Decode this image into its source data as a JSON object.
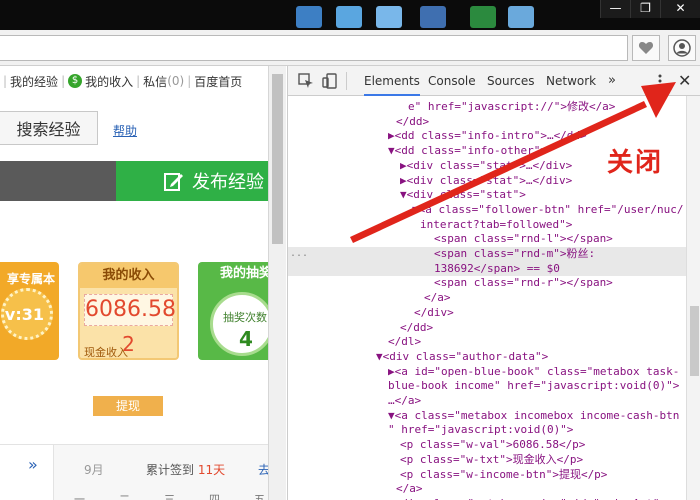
{
  "os": {
    "window_buttons": {
      "minimize": "—",
      "restore": "❐",
      "close": "✕"
    }
  },
  "browser": {
    "url_value": "",
    "favorite_icon": "heart-icon",
    "account_icon": "user-icon"
  },
  "page": {
    "nav": {
      "items": [
        "我的经验",
        "我的收入",
        "私信",
        "百度首页"
      ],
      "message_count": "(0)",
      "separator": "|"
    },
    "search_button": "搜索经验",
    "help_link": "帮助",
    "publish_button": "发布经验",
    "cards": {
      "exclusive": {
        "title": "享专属本",
        "badge": "v:31"
      },
      "income": {
        "title": "我的收入",
        "amount": "6086.58",
        "count": "2",
        "sub_label": "现金收入"
      },
      "lottery": {
        "title": "我的抽奖",
        "label": "抽奖次数",
        "value": "4"
      }
    },
    "withdraw_button": "提现",
    "calendar": {
      "arrow": "»",
      "month": "9月",
      "total_prefix": "累计签到",
      "total_days": "11天",
      "more": "去",
      "weekdays": [
        "一",
        "二",
        "三",
        "四",
        "五"
      ]
    }
  },
  "devtools": {
    "tabs": [
      "Elements",
      "Console",
      "Sources",
      "Network"
    ],
    "active_tab": "Elements",
    "more_tabs": "»",
    "close_label": "✕"
  },
  "dom_lines": [
    {
      "text": "e\" href=\"javascript://\">修改</a>"
    },
    {
      "text": "</dd>"
    },
    {
      "text": "▶<dd class=\"info-intro\">…</dd>"
    },
    {
      "text": "▼<dd class=\"info-other\">"
    },
    {
      "text": "▶<div class=\"stat\">…</div>"
    },
    {
      "text": "▶<div class=\"stat\">…</div>"
    },
    {
      "text": "▼<div class=\"stat\">"
    },
    {
      "text": "▼<a class=\"follower-btn\" href=\"/user/nuc/"
    },
    {
      "text": "interact?tab=followed\">"
    },
    {
      "text": "<span class=\"rnd-l\"></span>"
    },
    {
      "text": "<span class=\"rnd-m\">粉丝:"
    },
    {
      "text": "138692</span> == $0"
    },
    {
      "text": "<span class=\"rnd-r\"></span>"
    },
    {
      "text": "</a>"
    },
    {
      "text": "</div>"
    },
    {
      "text": "</dd>"
    },
    {
      "text": "</dl>"
    },
    {
      "text": "▼<div class=\"author-data\">"
    },
    {
      "text": "▶<a id=\"open-blue-book\" class=\"metabox task-"
    },
    {
      "text": "blue-book income\" href=\"javascript:void(0)\">"
    },
    {
      "text": "…</a>"
    },
    {
      "text": "▼<a class=\"metabox incomebox income-cash-btn"
    },
    {
      "text": "\" href=\"javascript:void(0)\">"
    },
    {
      "text": "<p class=\"w-val\">6086.58</p>"
    },
    {
      "text": "<p class=\"w-txt\">现金收入</p>"
    },
    {
      "text": "<p class=\"w-income-btn\">提现</p>"
    },
    {
      "text": "</a>"
    },
    {
      "text": "▶<div class=\"metabox prize\" id=\"prizeAct\">"
    }
  ],
  "annotation": {
    "label": "关闭",
    "color": "#e0251b"
  }
}
